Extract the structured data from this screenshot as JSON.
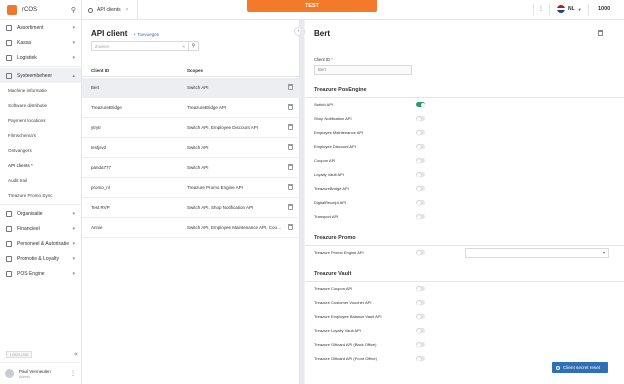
{
  "app": {
    "name": "rCOS"
  },
  "sidebar": {
    "groups_top": [
      {
        "label": "Assortiment",
        "icon": "tag-icon"
      },
      {
        "label": "Kassa",
        "icon": "register-icon"
      },
      {
        "label": "Logistiek",
        "icon": "truck-icon"
      }
    ],
    "open_group": {
      "label": "Systeembeheer",
      "icon": "gear-icon"
    },
    "sub_items": [
      "Machine informatie",
      "Software distributie",
      "Payment locations",
      "Filmschema's",
      "Ontvangers",
      "API clients *",
      "Audit trail",
      "Treazure Promo Sync"
    ],
    "groups_bottom": [
      {
        "label": "Organisatie",
        "icon": "building-icon"
      },
      {
        "label": "Financieel",
        "icon": "money-icon"
      },
      {
        "label": "Personeel & Autorisatie",
        "icon": "people-icon"
      },
      {
        "label": "Promotie & Loyalty",
        "icon": "star-icon"
      },
      {
        "label": "POS Engine",
        "icon": "chip-icon"
      }
    ],
    "version": "1.0820.1936",
    "user": {
      "name": "Paul Vermeulen",
      "role": "Admin"
    }
  },
  "topbar": {
    "tab_label": "API clients",
    "environment": "TEST",
    "language": "NL",
    "store": "1000"
  },
  "list": {
    "title": "API client",
    "add_label": "+ Toevoegen",
    "search_placeholder": "Zoeken",
    "col_id": "Client ID",
    "col_scopes": "Scopes",
    "rows": [
      {
        "id": "Bert",
        "scopes": "Switch API"
      },
      {
        "id": "TreazureBridge",
        "scopes": "TreazureBridge API"
      },
      {
        "id": "ytrytr",
        "scopes": "Switch API, Employee Discount API"
      },
      {
        "id": "testjsv2",
        "scopes": "Switch API"
      },
      {
        "id": "panda777",
        "scopes": "Switch API"
      },
      {
        "id": "promo_nl",
        "scopes": "Treazure Promo Engine API"
      },
      {
        "id": "Test RVP",
        "scopes": "Switch API, Shop Notification API"
      },
      {
        "id": "Annie",
        "scopes": "Switch API, Employee Maintenance API, Coupon API"
      }
    ]
  },
  "detail": {
    "title": "Bert",
    "client_id_label": "Client ID",
    "client_id_value": "Bert",
    "sections": [
      {
        "title": "Treazure PosEngine",
        "options": [
          {
            "label": "Switch API",
            "on": true
          },
          {
            "label": "Shop Notification API",
            "on": false
          },
          {
            "label": "Employee Maintenance API",
            "on": false
          },
          {
            "label": "Employee Discount API",
            "on": false
          },
          {
            "label": "Coupon API",
            "on": false
          },
          {
            "label": "Loyalty Vault API",
            "on": false
          },
          {
            "label": "TreazureBridge API",
            "on": false
          },
          {
            "label": "DigitalReceipt API",
            "on": false
          },
          {
            "label": "Transport API",
            "on": false
          }
        ]
      },
      {
        "title": "Treazure Promo",
        "options": [
          {
            "label": "Treazure Promo Engine API",
            "on": false
          }
        ]
      },
      {
        "title": "Treazure Vault",
        "options": [
          {
            "label": "Treazure Coupon API",
            "on": false
          },
          {
            "label": "Treazure Customer Voucher API",
            "on": false
          },
          {
            "label": "Treazure Employee Balance Vault API",
            "on": false
          },
          {
            "label": "Treazure Loyalty Vault API",
            "on": false
          },
          {
            "label": "Treazure Giftcard API (Back Office)",
            "on": false
          },
          {
            "label": "Treazure Giftcard API (Front Office)",
            "on": false
          }
        ]
      }
    ],
    "secret_reset_label": "Client secret reset"
  },
  "colors": {
    "accent": "#f27a2a",
    "primary": "#2f6fb5",
    "toggle_on": "#2e9d66"
  }
}
